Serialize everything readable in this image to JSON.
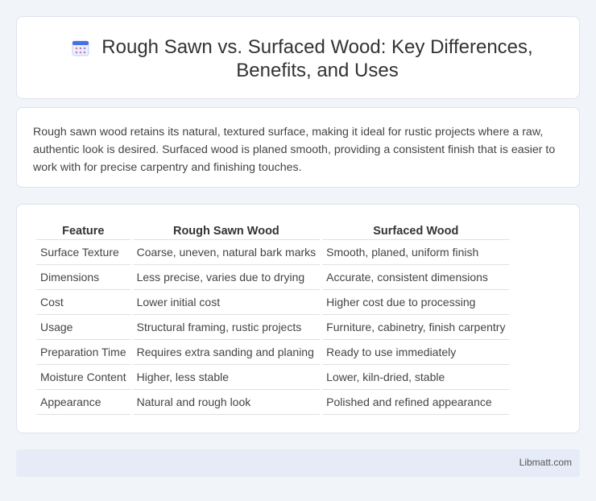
{
  "header": {
    "icon": "calendar-icon",
    "title": "Rough Sawn vs. Surfaced Wood: Key Differences, Benefits, and Uses"
  },
  "intro": {
    "text": "Rough sawn wood retains its natural, textured surface, making it ideal for rustic projects where a raw, authentic look is desired. Surfaced wood is planed smooth, providing a consistent finish that is easier to work with for precise carpentry and finishing touches."
  },
  "table": {
    "headers": [
      "Feature",
      "Rough Sawn Wood",
      "Surfaced Wood"
    ],
    "rows": [
      [
        "Surface Texture",
        "Coarse, uneven, natural bark marks",
        "Smooth, planed, uniform finish"
      ],
      [
        "Dimensions",
        "Less precise, varies due to drying",
        "Accurate, consistent dimensions"
      ],
      [
        "Cost",
        "Lower initial cost",
        "Higher cost due to processing"
      ],
      [
        "Usage",
        "Structural framing, rustic projects",
        "Furniture, cabinetry, finish carpentry"
      ],
      [
        "Preparation Time",
        "Requires extra sanding and planing",
        "Ready to use immediately"
      ],
      [
        "Moisture Content",
        "Higher, less stable",
        "Lower, kiln-dried, stable"
      ],
      [
        "Appearance",
        "Natural and rough look",
        "Polished and refined appearance"
      ]
    ]
  },
  "footer": {
    "text": "Libmatt.com"
  }
}
